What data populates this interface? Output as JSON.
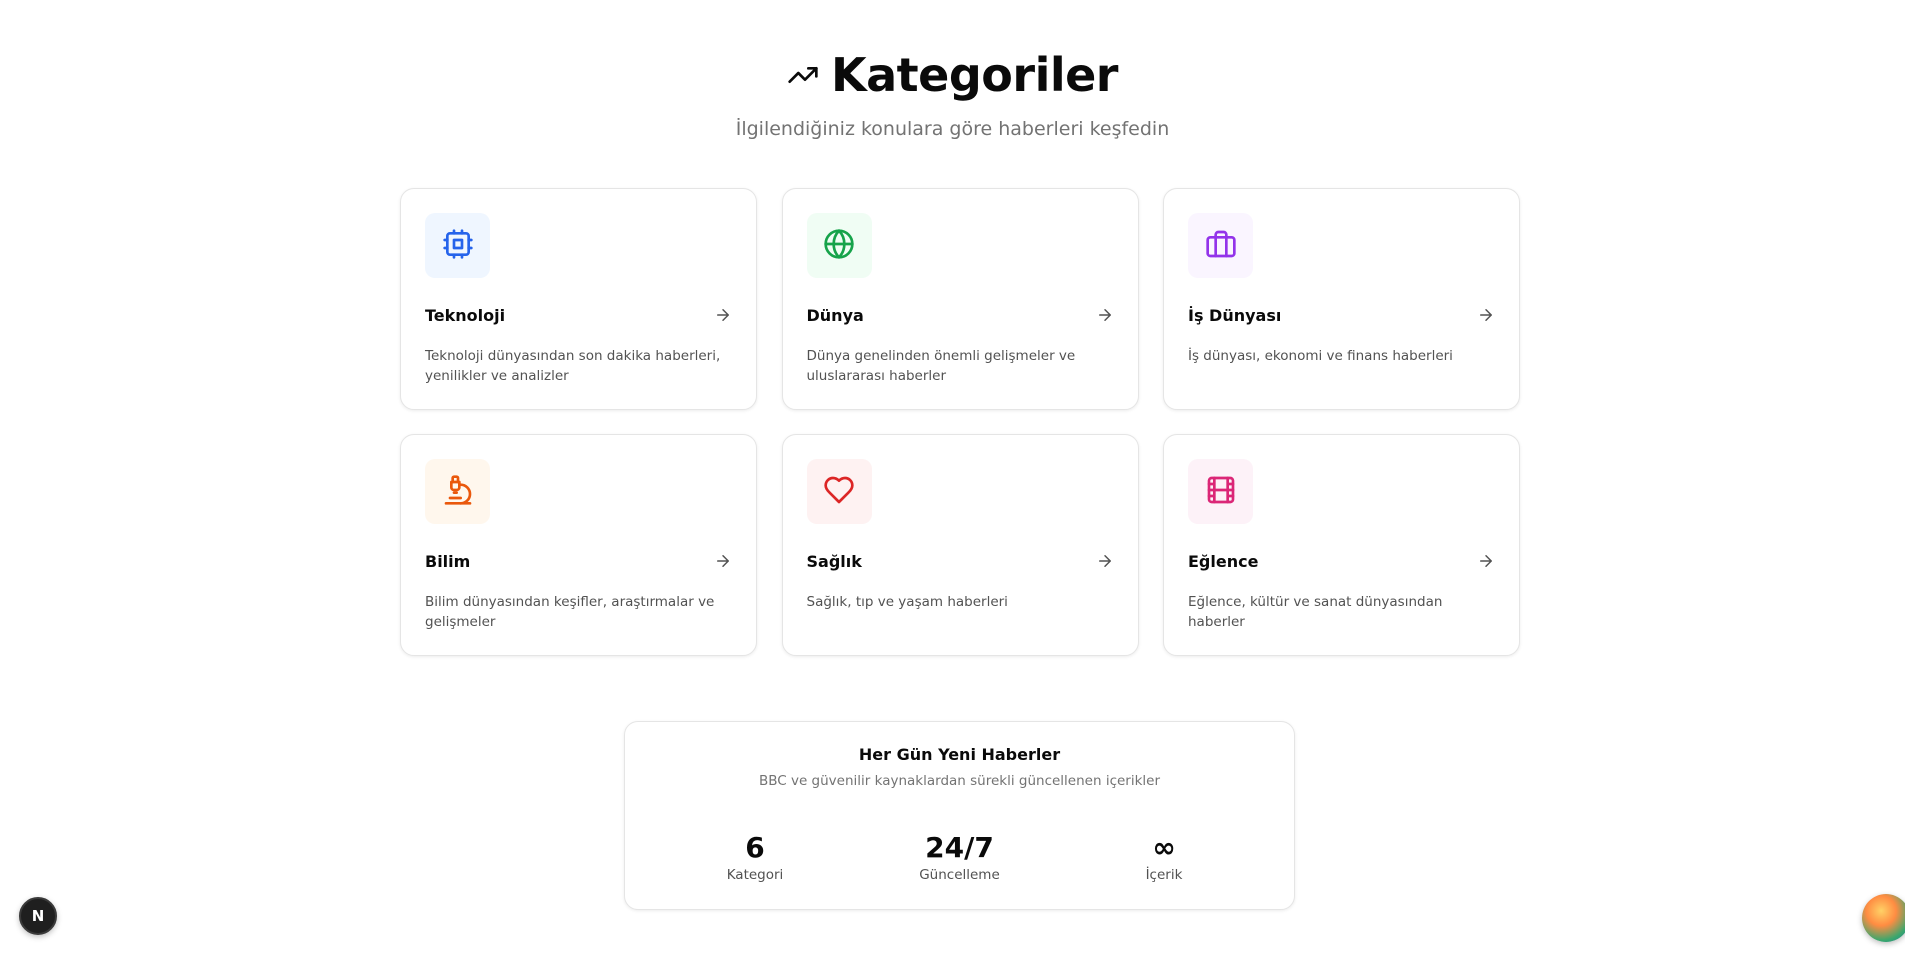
{
  "header": {
    "title": "Kategoriler",
    "subtitle": "İlgilendiğiniz konulara göre haberleri keşfedin",
    "icon": "trending-up-icon"
  },
  "categories": [
    {
      "name": "Teknoloji",
      "description": "Teknoloji dünyasından son dakika haberleri, yenilikler ve analizler",
      "icon": "cpu-icon",
      "color": "#2563eb",
      "bg": "#eff6ff"
    },
    {
      "name": "Dünya",
      "description": "Dünya genelinden önemli gelişmeler ve uluslararası haberler",
      "icon": "globe-icon",
      "color": "#16a34a",
      "bg": "#f0fdf4"
    },
    {
      "name": "İş Dünyası",
      "description": "İş dünyası, ekonomi ve finans haberleri",
      "icon": "briefcase-icon",
      "color": "#9333ea",
      "bg": "#faf5ff"
    },
    {
      "name": "Bilim",
      "description": "Bilim dünyasından keşifler, araştırmalar ve gelişmeler",
      "icon": "microscope-icon",
      "color": "#ea580c",
      "bg": "#fff7ed"
    },
    {
      "name": "Sağlık",
      "description": "Sağlık, tıp ve yaşam haberleri",
      "icon": "heart-icon",
      "color": "#dc2626",
      "bg": "#fef2f2"
    },
    {
      "name": "Eğlence",
      "description": "Eğlence, kültür ve sanat dünyasından haberler",
      "icon": "film-icon",
      "color": "#db2777",
      "bg": "#fdf2f8"
    }
  ],
  "stats": {
    "title": "Her Gün Yeni Haberler",
    "subtitle": "BBC ve güvenilir kaynaklardan sürekli güncellenen içerikler",
    "items": [
      {
        "value": "6",
        "label": "Kategori"
      },
      {
        "value": "24/7",
        "label": "Güncelleme"
      },
      {
        "value": "∞",
        "label": "İçerik"
      }
    ]
  },
  "badge": {
    "letter": "N"
  }
}
